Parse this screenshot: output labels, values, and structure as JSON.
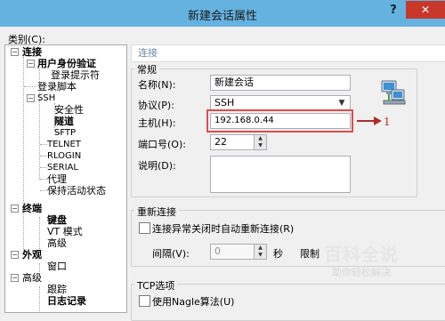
{
  "window": {
    "title": "新建会话属性",
    "help_label": "?",
    "close_label": "✕"
  },
  "category": {
    "label": "类别(C):",
    "items": [
      {
        "label": "连接"
      },
      {
        "label": "用户身份验证"
      },
      {
        "label": "登录提示符"
      },
      {
        "label": "登录脚本"
      },
      {
        "label": "SSH"
      },
      {
        "label": "安全性"
      },
      {
        "label": "隧道"
      },
      {
        "label": "SFTP"
      },
      {
        "label": "TELNET"
      },
      {
        "label": "RLOGIN"
      },
      {
        "label": "SERIAL"
      },
      {
        "label": "代理"
      },
      {
        "label": "保持活动状态"
      },
      {
        "label": "终端"
      },
      {
        "label": "键盘"
      },
      {
        "label": "VT 模式"
      },
      {
        "label": "高级"
      },
      {
        "label": "外观"
      },
      {
        "label": "窗口"
      },
      {
        "label": "高级"
      },
      {
        "label": "跟踪"
      },
      {
        "label": "日志记录"
      }
    ]
  },
  "panel": {
    "title": "连接",
    "general": {
      "title": "常规",
      "name_label": "名称(N):",
      "name_value": "新建会话",
      "protocol_label": "协议(P):",
      "protocol_value": "SSH",
      "host_label": "主机(H):",
      "host_value": "192.168.0.44",
      "port_label": "端口号(O):",
      "port_value": "22",
      "desc_label": "说明(D):",
      "desc_value": ""
    },
    "annotation_number": "1",
    "reconnect": {
      "title": "重新连接",
      "checkbox_label": "连接异常关闭时自动重新连接(R)",
      "interval_label": "间隔(V):",
      "interval_value": "0",
      "seconds_label": "秒",
      "limit_label": "限制"
    },
    "tcp": {
      "title": "TCP选项",
      "nagle_label": "使用Nagle算法(U)"
    }
  },
  "watermark": {
    "title": "百科全说",
    "subtitle": "助你轻松解决"
  }
}
